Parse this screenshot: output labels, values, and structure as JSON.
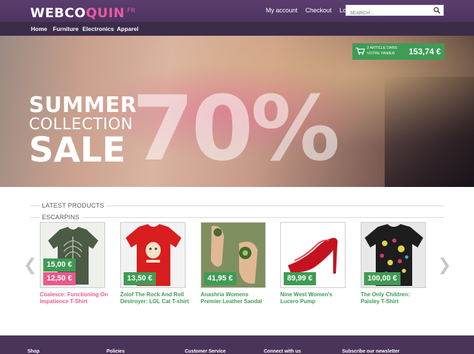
{
  "header": {
    "logo_main": "WEBCO",
    "logo_accent": "QUIN",
    "logo_tld": ".FR",
    "links": [
      "My account",
      "Checkout",
      "Log in"
    ],
    "search_placeholder": "SEARCH..."
  },
  "nav": {
    "items": [
      "Home",
      "Furniture",
      "Electronics",
      "Apparel"
    ]
  },
  "hero": {
    "line1": "SUMMER",
    "line2": "COLLECTION",
    "line3": "SALE",
    "percent": "70%",
    "cart": {
      "count_text_1": "2 ARTICLE DANS",
      "count_text_2": "VOTRE PANIER",
      "total": "153,74 €"
    }
  },
  "sections": {
    "latest": "LATEST PRODUCTS",
    "category": "ESCARPINS"
  },
  "products": [
    {
      "name": "Coalesce: Functioning On Impatience T-Shirt",
      "price": "15,00 €",
      "sale_price": "12,50 €",
      "on_sale": true
    },
    {
      "name": "Zolof The Rock And Roll Destroyer: LOL Cat T-shirt",
      "price": "13,50 €"
    },
    {
      "name": "Anashria Womens Premier Leather Sandal",
      "price": "41,95 €"
    },
    {
      "name": "Nine West Women's Lucero Pump",
      "price": "89,99 €"
    },
    {
      "name": "The Only Children: Paisley T-Shirt",
      "price": "100,00 €"
    }
  ],
  "footer": {
    "columns": [
      "Shop",
      "Policies",
      "Customer Service",
      "Connect with us",
      "Subscribe our newsletter"
    ]
  },
  "colors": {
    "brand_purple": "#4e3461",
    "accent_green": "#3f9b55",
    "accent_pink": "#e85a8c"
  }
}
